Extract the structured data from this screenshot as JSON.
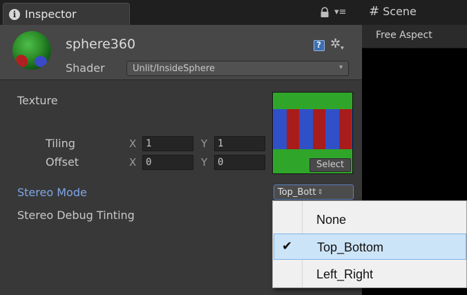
{
  "inspector_tab": {
    "label": "Inspector",
    "icon": "info-icon"
  },
  "header": {
    "object_name": "sphere360",
    "shader_label": "Shader",
    "shader_value": "Unlit/InsideSphere"
  },
  "material": {
    "texture_label": "Texture",
    "tiling": {
      "label": "Tiling",
      "x_axis": "X",
      "x": "1",
      "y_axis": "Y",
      "y": "1"
    },
    "offset": {
      "label": "Offset",
      "x_axis": "X",
      "x": "0",
      "y_axis": "Y",
      "y": "0"
    },
    "texture_select_label": "Select",
    "stereo_mode_label": "Stereo Mode",
    "stereo_mode_value": "Top_Bott",
    "stereo_debug_label": "Stereo Debug Tinting"
  },
  "scene": {
    "tab_label": "Scene",
    "aspect_label": "Free Aspect"
  },
  "dropdown": {
    "options": [
      {
        "label": "None",
        "selected": false
      },
      {
        "label": "Top_Bottom",
        "selected": true
      },
      {
        "label": "Left_Right",
        "selected": false
      }
    ]
  },
  "colors": {
    "panel_bg": "#383838",
    "header_bg": "#474747",
    "accent_label": "#7fa7e8",
    "selection_bg": "#cce4f7"
  }
}
